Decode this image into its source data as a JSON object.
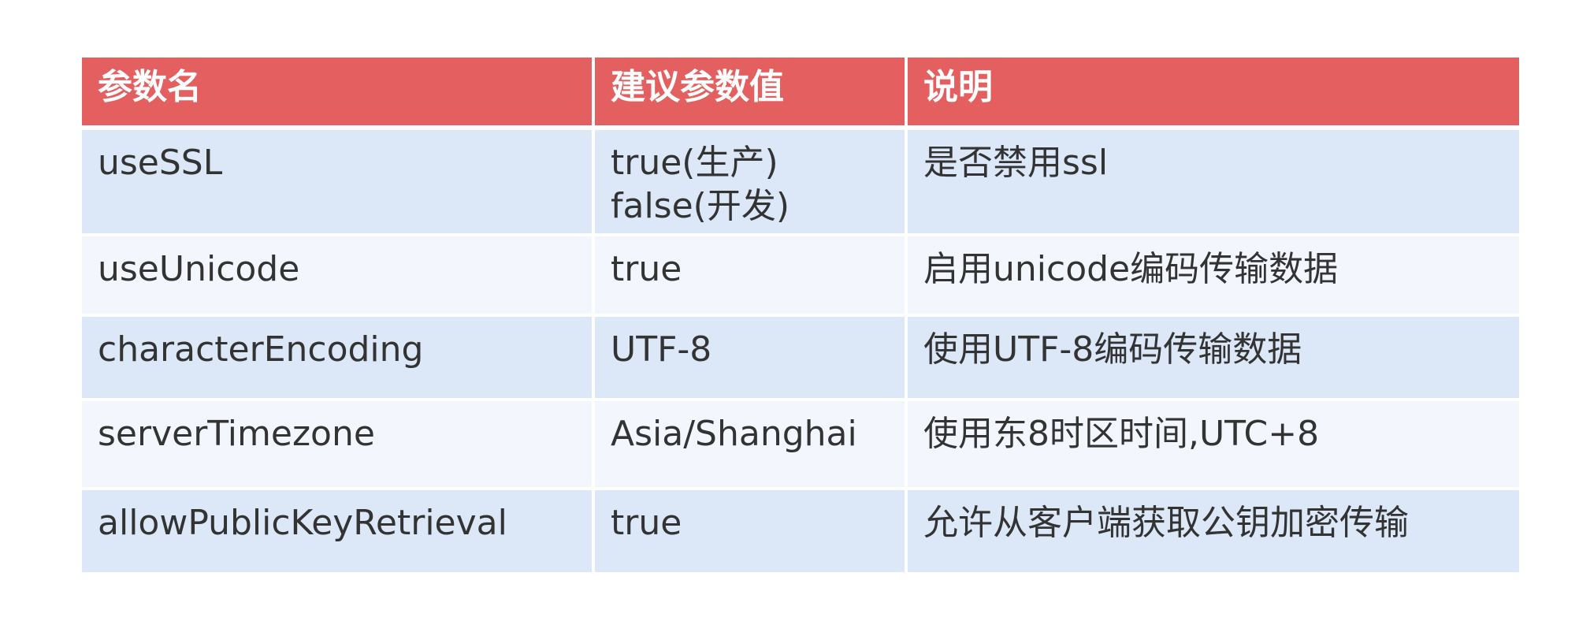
{
  "table": {
    "headers": [
      "参数名",
      "建议参数值",
      "说明"
    ],
    "rows": [
      {
        "name": "useSSL",
        "value_lines": [
          "true(生产)",
          "false(开发)"
        ],
        "desc": "是否禁用ssl"
      },
      {
        "name": "useUnicode",
        "value_lines": [
          "true"
        ],
        "desc": "启用unicode编码传输数据"
      },
      {
        "name": "characterEncoding",
        "value_lines": [
          "UTF-8"
        ],
        "desc": "使用UTF-8编码传输数据"
      },
      {
        "name": "serverTimezone",
        "value_lines": [
          "Asia/Shanghai"
        ],
        "desc": "使用东8时区时间,UTC+8"
      },
      {
        "name": "allowPublicKeyRetrieval",
        "value_lines": [
          "true"
        ],
        "desc": "允许从客户端获取公钥加密传输"
      }
    ]
  },
  "colors": {
    "header_bg": "#e46060",
    "row_odd_bg": "#dce7f8",
    "row_even_bg": "#f3f7fd",
    "text": "#333333"
  }
}
